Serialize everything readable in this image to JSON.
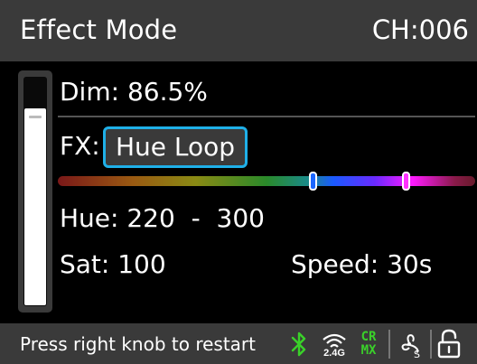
{
  "header": {
    "title": "Effect Mode",
    "channel": "CH:006"
  },
  "dim": {
    "label": "Dim: 86.5%",
    "level_percent": 86.5
  },
  "fx": {
    "label": "FX:",
    "value": "Hue Loop"
  },
  "hue_range": {
    "start": 220,
    "end": 300
  },
  "hue": {
    "label": "Hue: 220  -  300"
  },
  "sat": {
    "label": "Sat: 100"
  },
  "speed": {
    "label": "Speed: 30s"
  },
  "footer": {
    "hint": "Press right knob to restart",
    "icons": [
      "bluetooth-icon",
      "wireless-2.4g-icon",
      "crmx-icon",
      "fan-smart-icon",
      "lock-open-icon"
    ],
    "wireless_label": "2.4G",
    "crmx_top": "CR",
    "crmx_bottom": "MX",
    "fan_label": "S"
  },
  "colors": {
    "accent": "#1fb0e8",
    "panel": "#3a3a3a",
    "wireless_green": "#3ad12a"
  }
}
